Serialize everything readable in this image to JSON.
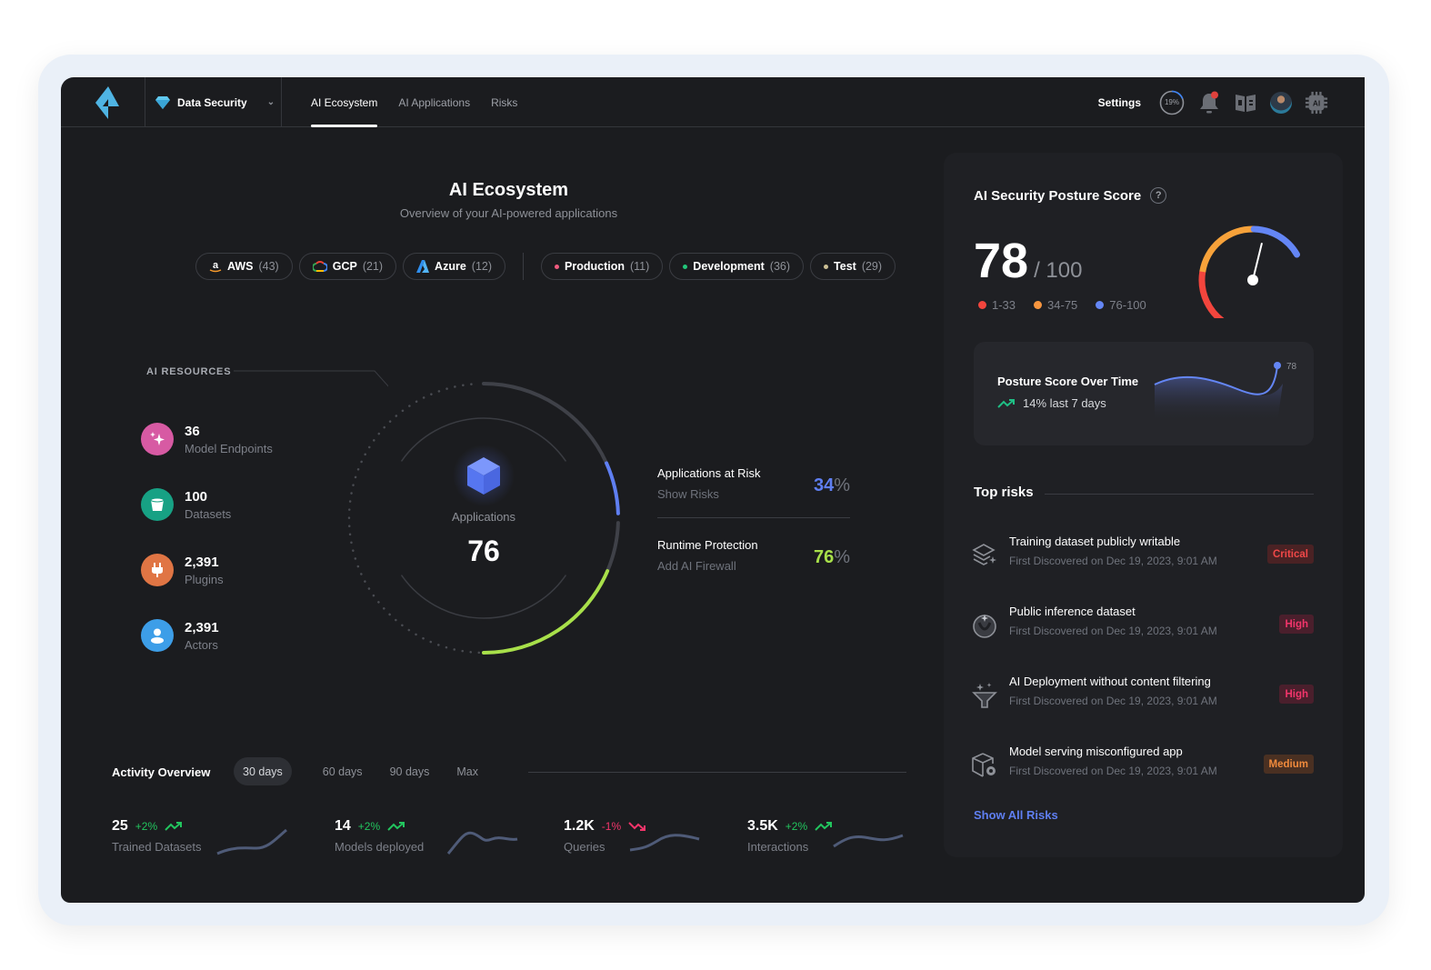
{
  "topbar": {
    "product": "Data Security",
    "tabs": [
      {
        "label": "AI Ecosystem",
        "active": true
      },
      {
        "label": "AI Applications",
        "active": false
      },
      {
        "label": "Risks",
        "active": false
      }
    ],
    "settings_label": "Settings",
    "progress_label": "19%",
    "progress_value": 0.19,
    "icons": [
      "bell-icon",
      "book-icon",
      "avatar",
      "ai-chip-icon"
    ]
  },
  "main": {
    "title": "AI Ecosystem",
    "subtitle": "Overview of your AI-powered applications",
    "clouds": [
      {
        "name": "AWS",
        "count": "(43)",
        "icon": "amazon-icon"
      },
      {
        "name": "GCP",
        "count": "(21)",
        "icon": "gcp-icon"
      },
      {
        "name": "Azure",
        "count": "(12)",
        "icon": "azure-icon"
      }
    ],
    "environments": [
      {
        "name": "Production",
        "count": "(11)",
        "color": "#f05a7e"
      },
      {
        "name": "Development",
        "count": "(36)",
        "color": "#22c77a"
      },
      {
        "name": "Test",
        "count": "(29)",
        "color": "#cbbf94"
      }
    ],
    "resources_label": "AI RESOURCES",
    "resources": [
      {
        "value": "36",
        "label": "Model Endpoints",
        "color": "#d75aa3",
        "icon": "sparkles-icon"
      },
      {
        "value": "100",
        "label": "Datasets",
        "color": "#17a184",
        "icon": "bucket-icon"
      },
      {
        "value": "2,391",
        "label": "Plugins",
        "color": "#e07544",
        "icon": "plug-icon"
      },
      {
        "value": "2,391",
        "label": "Actors",
        "color": "#3d9ee8",
        "icon": "user-icon"
      }
    ],
    "applications_label": "Applications",
    "applications_value": "76",
    "stats": [
      {
        "title": "Applications at Risk",
        "link": "Show Risks",
        "value": "34",
        "unit": "%",
        "color": "#5f7ff2",
        "fraction": 0.34
      },
      {
        "title": "Runtime Protection",
        "link": "Add AI Firewall",
        "value": "76",
        "unit": "%",
        "color": "#a8e04a",
        "fraction": 0.76
      }
    ],
    "activity": {
      "title": "Activity Overview",
      "ranges": [
        {
          "label": "30 days",
          "active": true
        },
        {
          "label": "60 days",
          "active": false
        },
        {
          "label": "90 days",
          "active": false
        },
        {
          "label": "Max",
          "active": false
        }
      ],
      "metrics": [
        {
          "value": "25",
          "delta": "+2%",
          "trend": "up",
          "label": "Trained Datasets"
        },
        {
          "value": "14",
          "delta": "+2%",
          "trend": "up",
          "label": "Models deployed"
        },
        {
          "value": "1.2K",
          "delta": "-1%",
          "trend": "down",
          "label": "Queries"
        },
        {
          "value": "3.5K",
          "delta": "+2%",
          "trend": "up",
          "label": "Interactions"
        }
      ]
    }
  },
  "posture": {
    "title": "AI Security Posture Score",
    "help": "?",
    "score": "78",
    "max": "/ 100",
    "score_fraction": 0.78,
    "legend": [
      {
        "label": "1-33",
        "color": "#f2453d"
      },
      {
        "label": "34-75",
        "color": "#f7963f"
      },
      {
        "label": "76-100",
        "color": "#6486f5"
      }
    ],
    "trend": {
      "title": "Posture Score Over Time",
      "subtitle": "14% last 7 days",
      "end_label": "78"
    }
  },
  "risks": {
    "title": "Top risks",
    "items": [
      {
        "title": "Training dataset publicly writable",
        "date": "First Discovered on Dec 19, 2023, 9:01 AM",
        "severity": "Critical",
        "icon": "layers-sparkle-icon"
      },
      {
        "title": "Public inference dataset",
        "date": "First Discovered on Dec 19, 2023, 9:01 AM",
        "severity": "High",
        "icon": "inference-icon"
      },
      {
        "title": "AI Deployment without content filtering",
        "date": "First Discovered on Dec 19, 2023, 9:01 AM",
        "severity": "High",
        "icon": "funnel-sparkle-icon"
      },
      {
        "title": "Model serving misconfigured app",
        "date": "First Discovered on Dec 19, 2023, 9:01 AM",
        "severity": "Medium",
        "icon": "cube-gear-icon"
      }
    ],
    "severity_colors": {
      "Critical": {
        "fg": "#f04848",
        "bg": "#4a2224"
      },
      "High": {
        "fg": "#f2356b",
        "bg": "#4a1f2c"
      },
      "Medium": {
        "fg": "#f08a3c",
        "bg": "#4a3022"
      }
    },
    "show_all": "Show All Risks"
  }
}
